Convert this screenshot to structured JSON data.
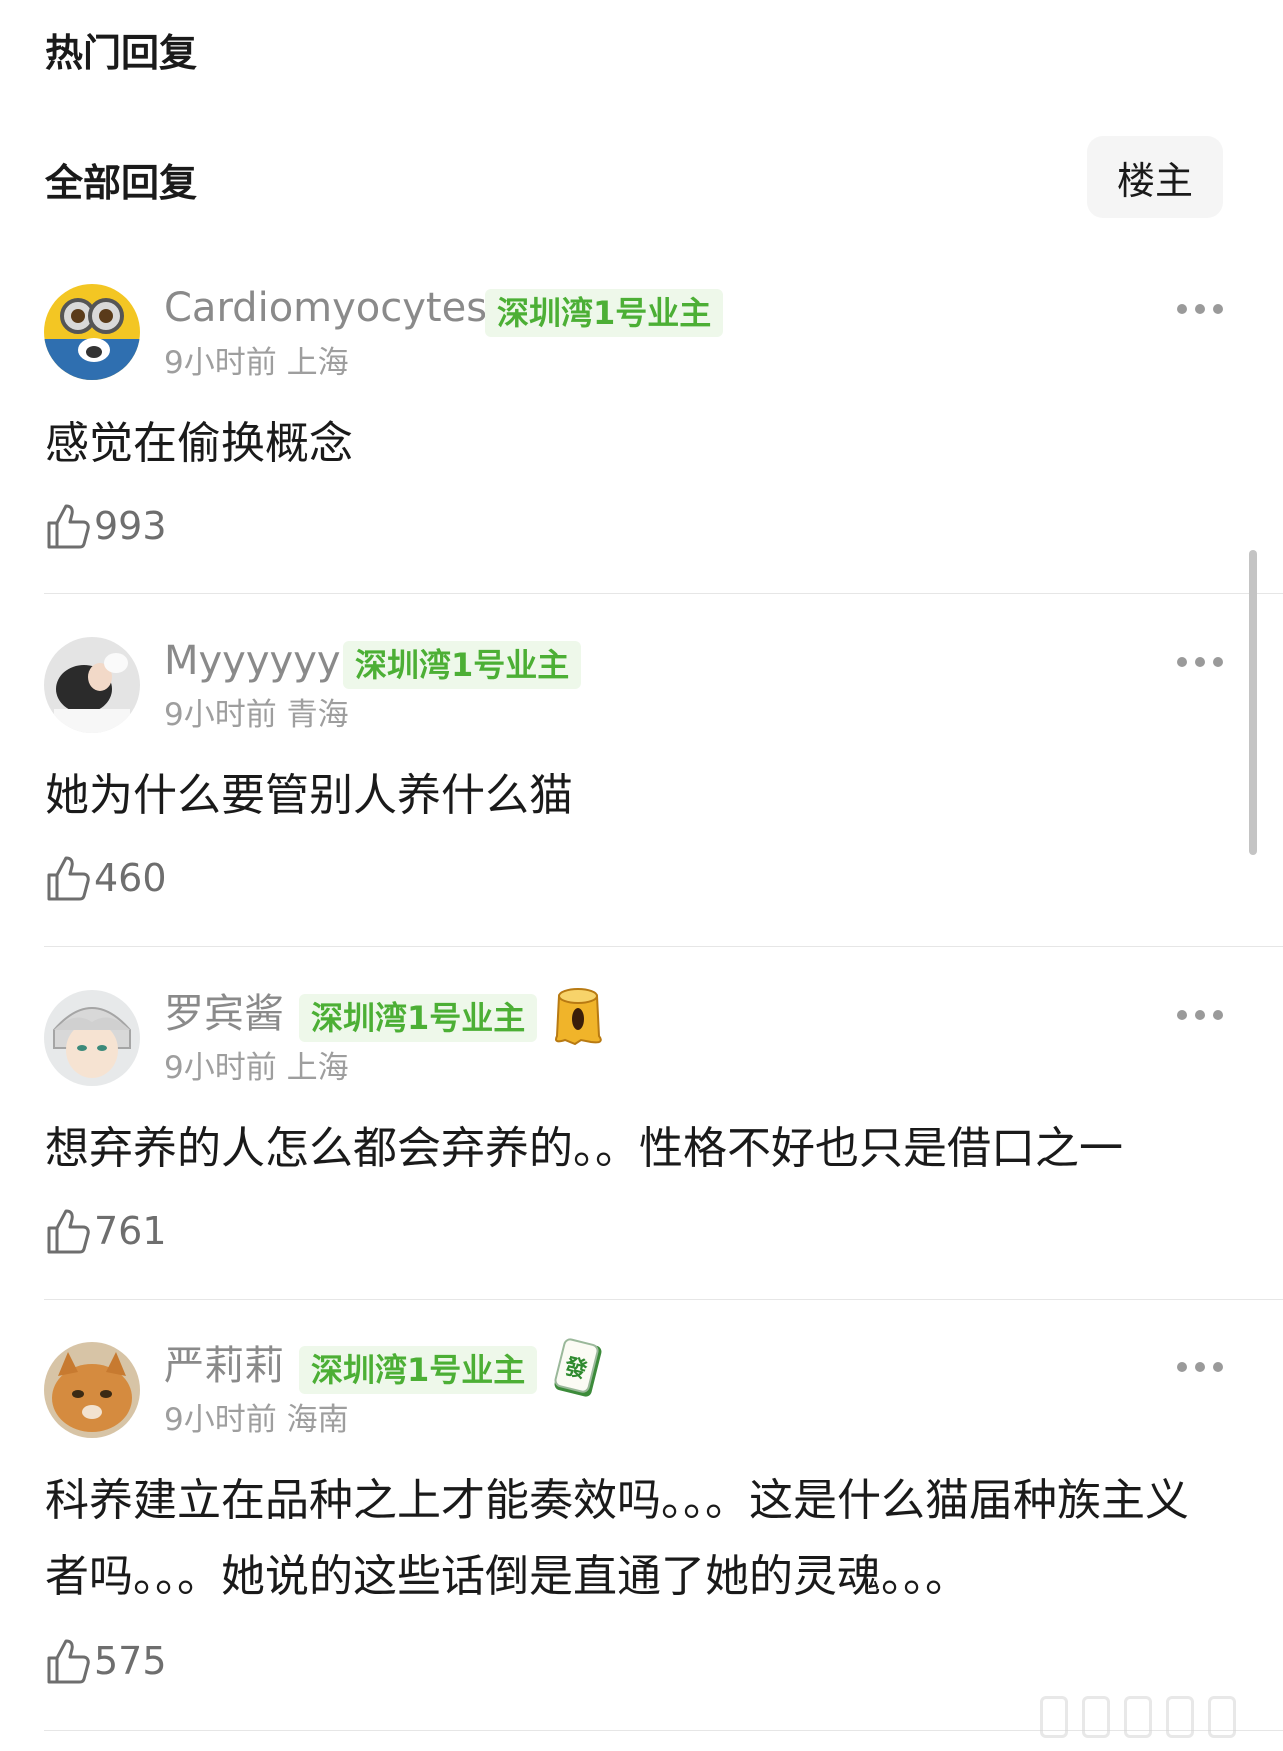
{
  "sections": {
    "hot_replies": "热门回复",
    "all_replies": "全部回复",
    "op_filter": "楼主"
  },
  "comments": [
    {
      "username": "Cardiomyocytes",
      "badge": "深圳湾1号业主",
      "time": "9小时前",
      "location": "上海",
      "text": "感觉在偷换概念",
      "likes": "993"
    },
    {
      "username": "Myyyyyy",
      "badge": "深圳湾1号业主",
      "time": "9小时前",
      "location": "青海",
      "text": "她为什么要管别人养什么猫",
      "likes": "460"
    },
    {
      "username": "罗宾酱",
      "badge": "深圳湾1号业主",
      "time": "9小时前",
      "location": "上海",
      "text": "想弃养的人怎么都会弃养的。。性格不好也只是借口之一",
      "likes": "761"
    },
    {
      "username": "严莉莉",
      "badge": "深圳湾1号业主",
      "time": "9小时前",
      "location": "海南",
      "text": "科养建立在品种之上才能奏效吗。。。这是什么猫届种族主义者吗。。。她说的这些话倒是直通了她的灵魂。。。",
      "likes": "575"
    }
  ],
  "colors": {
    "badge_text": "#4caf35",
    "badge_bg": "#eef8ea",
    "muted_text": "#8a8a8a"
  }
}
